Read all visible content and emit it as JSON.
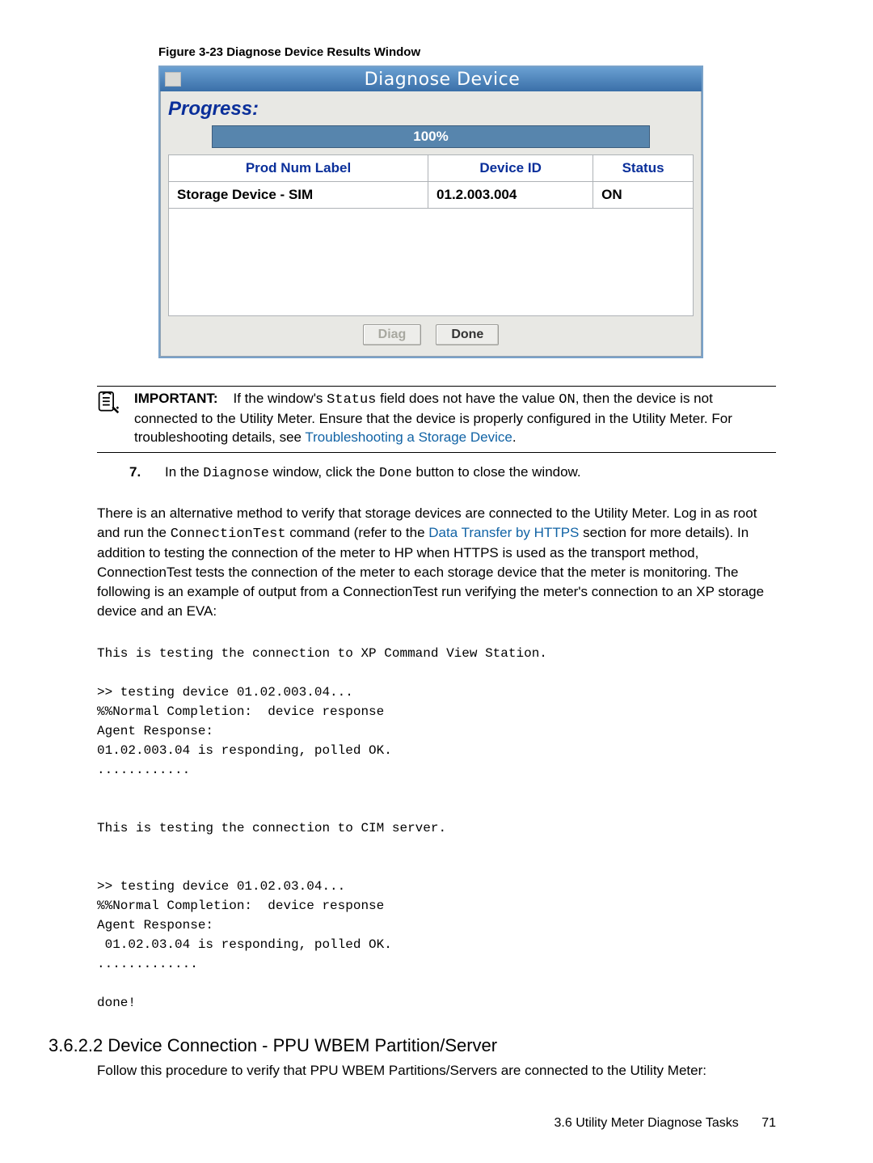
{
  "figure": {
    "caption": "Figure 3-23 Diagnose Device Results Window"
  },
  "dialog": {
    "title": "Diagnose Device",
    "progress_label": "Progress:",
    "progress_value": "100%",
    "columns": {
      "c1": "Prod Num Label",
      "c2": "Device ID",
      "c3": "Status"
    },
    "row": {
      "label": "Storage Device - SIM",
      "device_id": "01.2.003.004",
      "status": "ON"
    },
    "buttons": {
      "diag": "Diag",
      "done": "Done"
    }
  },
  "important": {
    "label": "IMPORTANT:",
    "text_before_code1": "If the window's ",
    "code1": "Status",
    "text_mid": " field does not have the value ",
    "code2": "ON",
    "text_after": ", then the device is not connected to the Utility Meter. Ensure that the device is properly configured in the Utility Meter. For troubleshooting details, see ",
    "link": "Troubleshooting a Storage Device",
    "tail": "."
  },
  "step7": {
    "num": "7.",
    "a": "In the ",
    "code_a": "Diagnose",
    "b": " window, click the ",
    "code_b": "Done",
    "c": " button to close the window."
  },
  "para_alt": {
    "a": "There is an alternative method to verify that storage devices are connected to the Utility Meter. Log in as root and run the ",
    "code": "ConnectionTest",
    "b": " command (refer to the ",
    "link": "Data Transfer by HTTPS",
    "c": " section for more details). In addition to testing the connection of the meter to HP when HTTPS is used as the transport method, ConnectionTest tests the connection of the meter to each storage device that the meter is monitoring. The following is an example of output from a ConnectionTest run verifying the meter's connection to an XP storage device and an EVA:"
  },
  "console_output": "This is testing the connection to XP Command View Station.\n\n>> testing device 01.02.003.04...\n%%Normal Completion:  device response\nAgent Response:\n01.02.003.04 is responding, polled OK.\n............\n\n\nThis is testing the connection to CIM server.\n\n\n>> testing device 01.02.03.04...\n%%Normal Completion:  device response\nAgent Response:\n 01.02.03.04 is responding, polled OK.\n.............\n\ndone!",
  "section": {
    "heading": "3.6.2.2 Device Connection - PPU WBEM Partition/Server",
    "body": "Follow this procedure to verify that PPU WBEM Partitions/Servers are connected to the Utility Meter:"
  },
  "footer": {
    "text": "3.6 Utility Meter Diagnose Tasks",
    "page": "71"
  }
}
